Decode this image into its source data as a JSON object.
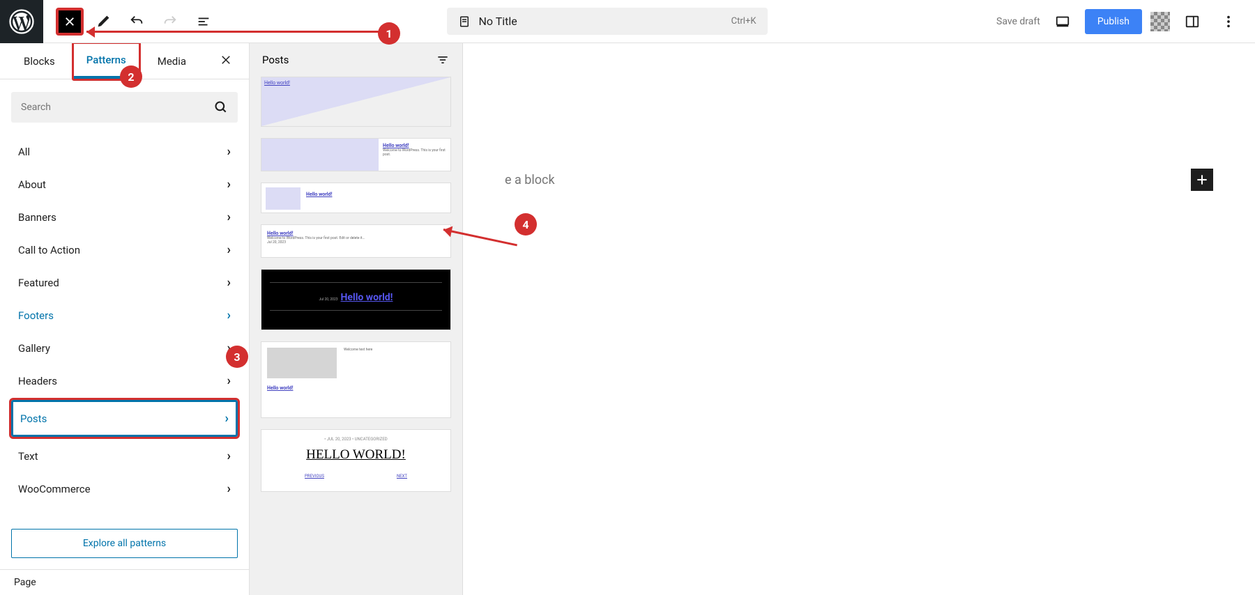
{
  "topbar": {
    "title": "No Title",
    "shortcut": "Ctrl+K"
  },
  "topActions": {
    "saveDraft": "Save draft",
    "publish": "Publish"
  },
  "tabs": {
    "blocks": "Blocks",
    "patterns": "Patterns",
    "media": "Media"
  },
  "search": {
    "placeholder": "Search"
  },
  "categories": [
    {
      "label": "All",
      "blue": false
    },
    {
      "label": "About",
      "blue": false
    },
    {
      "label": "Banners",
      "blue": false
    },
    {
      "label": "Call to Action",
      "blue": false
    },
    {
      "label": "Featured",
      "blue": false
    },
    {
      "label": "Footers",
      "blue": true
    },
    {
      "label": "Gallery",
      "blue": false
    },
    {
      "label": "Headers",
      "blue": false
    },
    {
      "label": "Posts",
      "blue": true,
      "selected": true
    },
    {
      "label": "Text",
      "blue": false
    },
    {
      "label": "WooCommerce",
      "blue": false
    }
  ],
  "exploreBtn": "Explore all patterns",
  "patternsPanel": {
    "title": "Posts",
    "samples": {
      "helloLink": "Hello world!",
      "bigHello": "HELLO WORLD!",
      "prev": "PREVIOUS",
      "next": "NEXT",
      "meta": "• JUL 20, 2023                    • UNCATEGORIZED"
    }
  },
  "editor": {
    "placeholder": "e a block"
  },
  "footer": {
    "label": "Page"
  },
  "annotations": {
    "n1": "1",
    "n2": "2",
    "n3": "3",
    "n4": "4"
  }
}
